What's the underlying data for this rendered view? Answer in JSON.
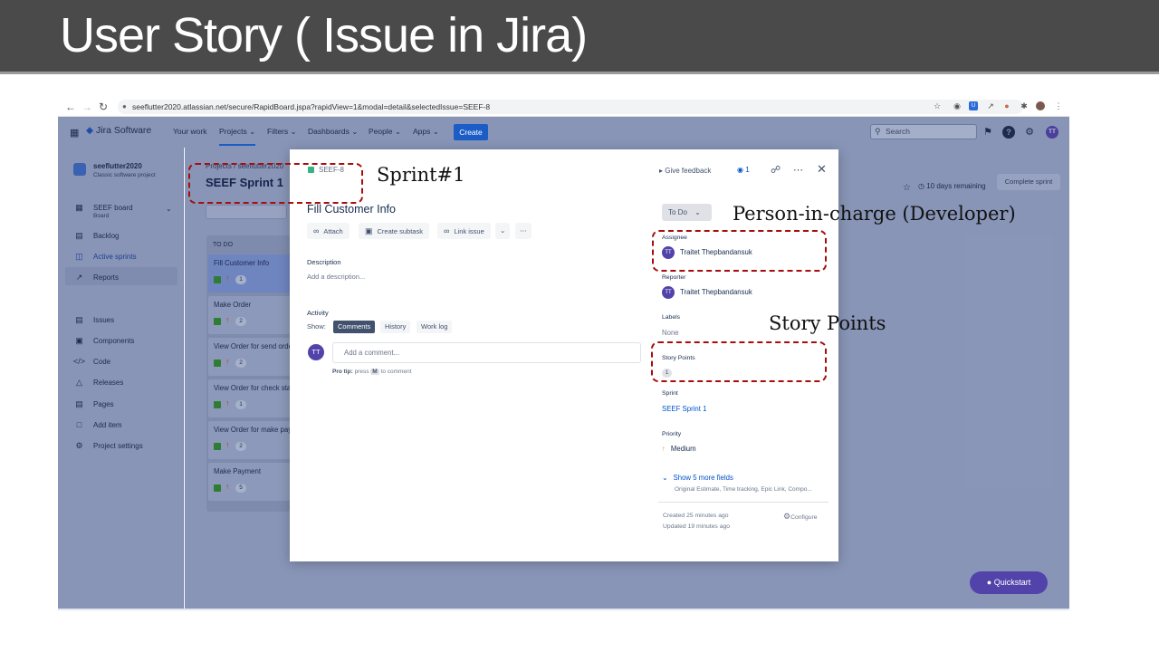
{
  "slide": {
    "title": "User Story ( Issue in Jira)",
    "annotations": {
      "sprint": "Sprint#1",
      "person": "Person-in-charge (Developer)",
      "story_points": "Story Points"
    }
  },
  "browser": {
    "url": "seeflutter2020.atlassian.net/secure/RapidBoard.jspa?rapidView=1&modal=detail&selectedIssue=SEEF-8"
  },
  "nav": {
    "logo": "Jira Software",
    "your_work": "Your work",
    "projects": "Projects",
    "filters": "Filters",
    "dashboards": "Dashboards",
    "people": "People",
    "apps": "Apps",
    "create": "Create",
    "search_placeholder": "Search",
    "avatar": "TT"
  },
  "sidebar": {
    "project_name": "seeflutter2020",
    "project_type": "Classic software project",
    "board_name": "SEEF board",
    "board_sub": "Board",
    "items": [
      {
        "label": "Backlog"
      },
      {
        "label": "Active sprints"
      },
      {
        "label": "Reports"
      },
      {
        "label": "Issues"
      },
      {
        "label": "Components"
      },
      {
        "label": "Code"
      },
      {
        "label": "Releases"
      },
      {
        "label": "Pages"
      },
      {
        "label": "Add item"
      },
      {
        "label": "Project settings"
      }
    ]
  },
  "board": {
    "breadcrumb": "Projects / seeflutter2020",
    "title": "SEEF Sprint 1",
    "column": "TO DO",
    "days_remaining": "10 days remaining",
    "complete_sprint": "Complete sprint",
    "cards": [
      {
        "title": "Fill Customer Info",
        "points": "1"
      },
      {
        "title": "Make Order",
        "points": "2"
      },
      {
        "title": "View Order for send order",
        "points": "2"
      },
      {
        "title": "View Order for check status",
        "points": "1"
      },
      {
        "title": "View Order for make payment",
        "points": "2"
      },
      {
        "title": "Make Payment",
        "points": "5"
      }
    ]
  },
  "modal": {
    "key": "SEEF-8",
    "title": "Fill Customer Info",
    "attach": "Attach",
    "create_subtask": "Create subtask",
    "link_issue": "Link issue",
    "description_label": "Description",
    "description_placeholder": "Add a description...",
    "activity_label": "Activity",
    "show_label": "Show:",
    "tabs": [
      "Comments",
      "History",
      "Work log"
    ],
    "avatar": "TT",
    "comment_placeholder": "Add a comment...",
    "protip_bold": "Pro tip:",
    "protip_press": "press",
    "protip_key": "M",
    "protip_rest": "to comment",
    "give_feedback": "Give feedback",
    "watchers": "1",
    "status": "To Do",
    "assignee_label": "Assignee",
    "assignee": "Traitet Thepbandansuk",
    "reporter_label": "Reporter",
    "reporter": "Traitet Thepbandansuk",
    "labels_label": "Labels",
    "labels_value": "None",
    "story_points_label": "Story Points",
    "story_points": "1",
    "sprint_label": "Sprint",
    "sprint_value": "SEEF Sprint 1",
    "priority_label": "Priority",
    "priority_value": "Medium",
    "more_fields": "Show 5 more fields",
    "more_fields_sub": "Original Estimate, Time tracking, Epic Link, Compo...",
    "created": "Created 25 minutes ago",
    "updated": "Updated 19 minutes ago",
    "configure": "Configure"
  },
  "quickstart": "Quickstart",
  "colors": {
    "title_bar": "#4a4a4a",
    "overlay": "#8895b7",
    "create_button": "#1b5cc7",
    "annotation": "#a60d0d",
    "quickstart": "#5243aa"
  }
}
